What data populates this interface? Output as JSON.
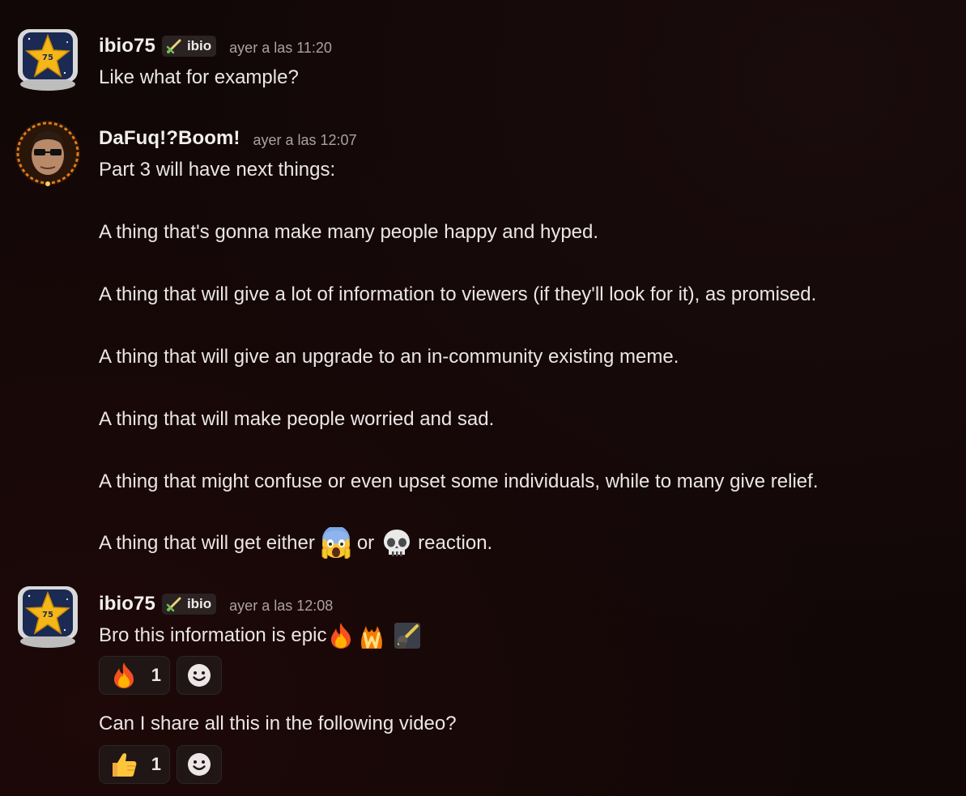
{
  "messages": [
    {
      "author": "ibio75",
      "tag": "ibio",
      "tag_icon": "sword-icon",
      "timestamp": "ayer a las 11:20",
      "lines": [
        "Like what for example?"
      ]
    },
    {
      "author": "DaFuq!?Boom!",
      "timestamp": "ayer a las 12:07",
      "lines": [
        "Part 3 will have next things:",
        "A thing that's gonna make many people happy and hyped.",
        "A thing that will give a lot of information to viewers (if they'll look for it), as promised.",
        "A thing that will give an upgrade to an in-community existing meme.",
        "A thing that will make people worried and sad.",
        "A thing that might confuse or even upset some individuals, while to many give relief.",
        "A thing that will get either",
        "or",
        "reaction."
      ]
    },
    {
      "author": "ibio75",
      "tag": "ibio",
      "tag_icon": "sword-icon",
      "timestamp": "ayer a las 12:08",
      "lines": [
        "Bro this information is epic",
        "Can I share all this in the following video?"
      ],
      "reactions": [
        {
          "emoji": "fire-icon",
          "count": "1"
        },
        {
          "emoji": "thumbs-up-icon",
          "count": "1"
        }
      ]
    }
  ],
  "colors": {
    "background": "#120707",
    "text": "#ebe6e6",
    "timestamp": "#aaa2a2",
    "tag_bg": "#2b2222"
  }
}
